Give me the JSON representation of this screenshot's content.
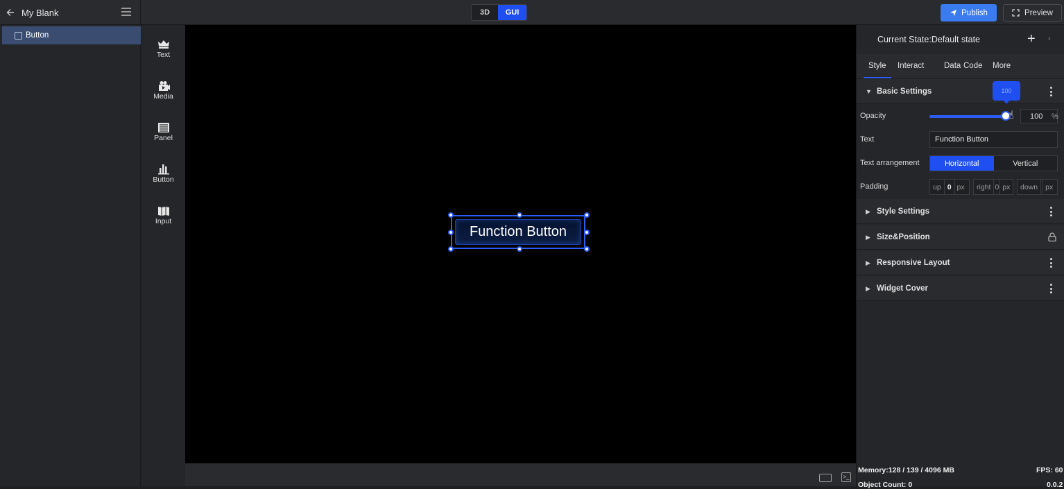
{
  "header": {
    "project_title": "My Blank",
    "mode_3d": "3D",
    "mode_gui": "GUI",
    "publish_label": "Publish",
    "preview_label": "Preview"
  },
  "layers": [
    {
      "label": "Button"
    }
  ],
  "toolbox": [
    {
      "label": "Text",
      "icon": "crown-icon"
    },
    {
      "label": "Media",
      "icon": "camera-icon"
    },
    {
      "label": "Panel",
      "icon": "panel-icon"
    },
    {
      "label": "Button",
      "icon": "chart-icon"
    },
    {
      "label": "Input",
      "icon": "input-icon"
    }
  ],
  "canvas": {
    "widget_text": "Function Button"
  },
  "inspector": {
    "state_text": "Current State:Default state",
    "tabs": [
      "Style",
      "Interact",
      "Data",
      "Code",
      "More"
    ],
    "active_tab": "Style",
    "sections": {
      "basic": "Basic Settings",
      "style": "Style Settings",
      "size": "Size&Position",
      "responsive": "Responsive Layout",
      "cover": "Widget Cover"
    },
    "opacity": {
      "label": "Opacity",
      "value": "100",
      "unit": "%",
      "tooltip": "100",
      "fraction": 1.0
    },
    "text_prop": {
      "label": "Text",
      "value": "Function Button"
    },
    "arrangement": {
      "label": "Text arrangement",
      "options": [
        "Horizontal",
        "Vertical"
      ],
      "selected": "Horizontal"
    },
    "padding": {
      "label": "Padding",
      "up_label": "up",
      "up_value": "0",
      "right_label": "right",
      "right_value": "0",
      "down_label": "down",
      "unit": "px"
    }
  },
  "status": {
    "memory": "Memory:128 / 139 / 4096 MB",
    "objects": "Object Count: 0",
    "fps": "FPS: 60",
    "version": "0.0.2"
  },
  "colors": {
    "accent": "#1f4ff0",
    "publish": "#3a7bef",
    "selected_layer": "#3a4d70"
  }
}
